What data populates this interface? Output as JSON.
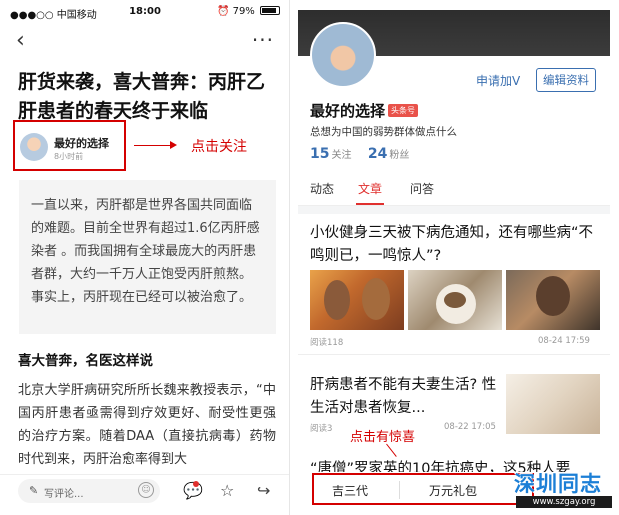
{
  "left_screen": {
    "status_bar": {
      "carrier": "●●●○○ 中国移动",
      "time": "18:00",
      "battery_text": "79%"
    },
    "nav": {
      "back_icon": "back-arrow-icon",
      "more_icon": "more-dots-icon"
    },
    "article": {
      "title": "肝货来袭，喜大普奔：丙肝乙肝患者的春天终于来临",
      "author_name": "最好的选择",
      "author_time": "8小时前",
      "quote": "一直以来，丙肝都是世界各国共同面临的难题。目前全世界有超过1.6亿丙肝感染者 。而我国拥有全球最庞大的丙肝患者群，大约一千万人正饱受丙肝煎熬。事实上，丙肝现在已经可以被治愈了。",
      "subheading": "喜大普奔，名医这样说",
      "body": "北京大学肝病研究所所长魏来教授表示，“中国丙肝患者亟需得到疗效更好、耐受性更强的治疗方案。随着DAA（直接抗病毒）药物时代到来，丙肝治愈率得到大"
    },
    "annotation_follow": "点击关注",
    "bottom_bar": {
      "comment_placeholder": "写评论...",
      "icons": [
        "pencil-icon",
        "emoji-icon",
        "comment-bubble-icon",
        "star-icon",
        "share-icon"
      ]
    }
  },
  "right_screen": {
    "profile": {
      "apply_v": "申请加V",
      "edit_profile": "编辑资料",
      "name": "最好的选择",
      "badge": "头条号",
      "bio": "总想为中国的弱势群体做点什么",
      "following_count": "15",
      "following_label": "关注",
      "fans_count": "24",
      "fans_label": "粉丝"
    },
    "tabs": [
      {
        "label": "动态",
        "active": false
      },
      {
        "label": "文章",
        "active": true
      },
      {
        "label": "问答",
        "active": false
      }
    ],
    "feed": [
      {
        "title": "小伙健身三天被下病危通知，还有哪些病“不鸣则已，一鸣惊人”?",
        "reads": "阅读118",
        "date": "08-24 17:59"
      },
      {
        "title": "肝病患者不能有夫妻生活? 性生活对患者恢复...",
        "reads": "阅读3",
        "date": "08-22 17:05"
      },
      {
        "title": "“唐僧”罗家英的10年抗癌史，这5种人要"
      }
    ],
    "annotation_surprise": "点击有惊喜",
    "bottom_menu": [
      "吉三代",
      "万元礼包"
    ]
  },
  "watermark": {
    "title": "深圳同志",
    "url": "www.szgay.org"
  },
  "colors": {
    "annotation_red": "#d40000",
    "link_blue": "#3a6fb0",
    "accent_red": "#e0302e",
    "watermark_blue": "#1c7fd6"
  }
}
